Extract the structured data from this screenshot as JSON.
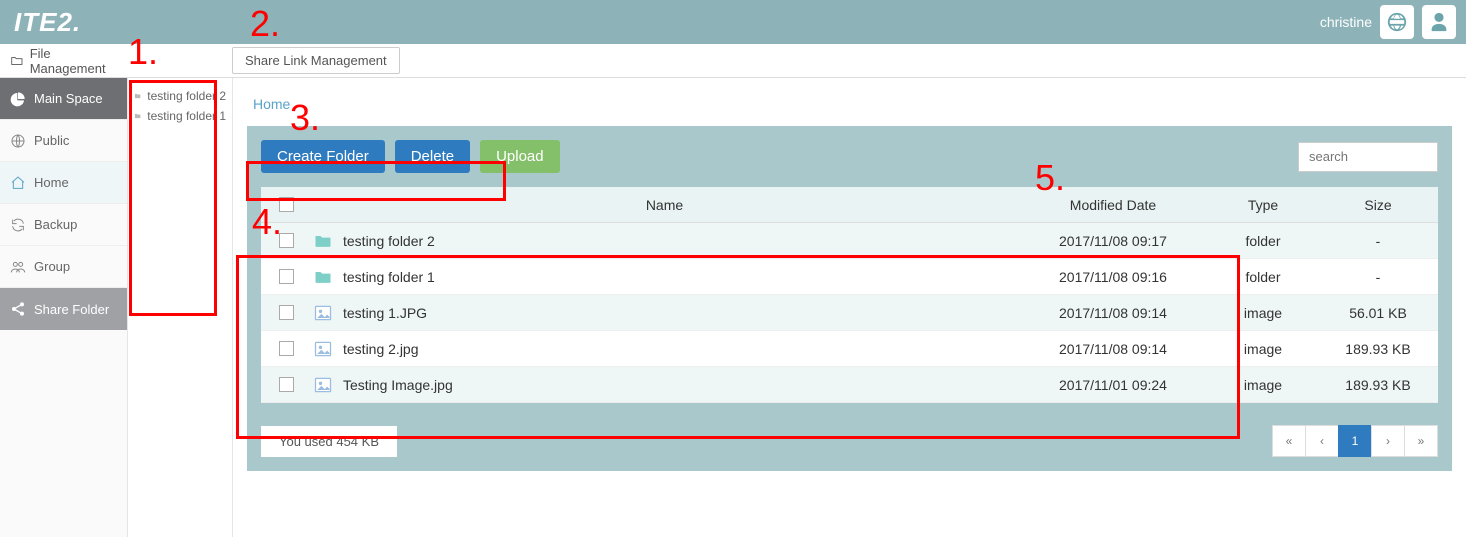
{
  "header": {
    "logo": "ITE2.",
    "username": "christine"
  },
  "row2": {
    "title": "File Management",
    "share_link_btn": "Share Link Management"
  },
  "sidebar": {
    "items": [
      {
        "label": "Main Space",
        "key": "main-space"
      },
      {
        "label": "Public",
        "key": "public"
      },
      {
        "label": "Home",
        "key": "home"
      },
      {
        "label": "Backup",
        "key": "backup"
      },
      {
        "label": "Group",
        "key": "group"
      },
      {
        "label": "Share Folder",
        "key": "share-folder"
      }
    ]
  },
  "tree": {
    "items": [
      {
        "label": "testing folder 2"
      },
      {
        "label": "testing folder 1"
      }
    ]
  },
  "breadcrumb": "Home",
  "toolbar": {
    "create_folder": "Create Folder",
    "delete": "Delete",
    "upload": "Upload",
    "search_placeholder": "search"
  },
  "table": {
    "headers": {
      "name": "Name",
      "date": "Modified Date",
      "type": "Type",
      "size": "Size"
    },
    "rows": [
      {
        "name": "testing folder 2",
        "date": "2017/11/08 09:17",
        "type": "folder",
        "size": "-",
        "icon": "folder"
      },
      {
        "name": "testing folder 1",
        "date": "2017/11/08 09:16",
        "type": "folder",
        "size": "-",
        "icon": "folder"
      },
      {
        "name": "testing 1.JPG",
        "date": "2017/11/08 09:14",
        "type": "image",
        "size": "56.01 KB",
        "icon": "image"
      },
      {
        "name": "testing 2.jpg",
        "date": "2017/11/08 09:14",
        "type": "image",
        "size": "189.93 KB",
        "icon": "image"
      },
      {
        "name": "Testing Image.jpg",
        "date": "2017/11/01 09:24",
        "type": "image",
        "size": "189.93 KB",
        "icon": "image"
      }
    ]
  },
  "footer": {
    "usage": "You used  454 KB",
    "page": "1"
  },
  "annotations": {
    "a1": "1.",
    "a2": "2.",
    "a3": "3.",
    "a4": "4.",
    "a5": "5."
  }
}
